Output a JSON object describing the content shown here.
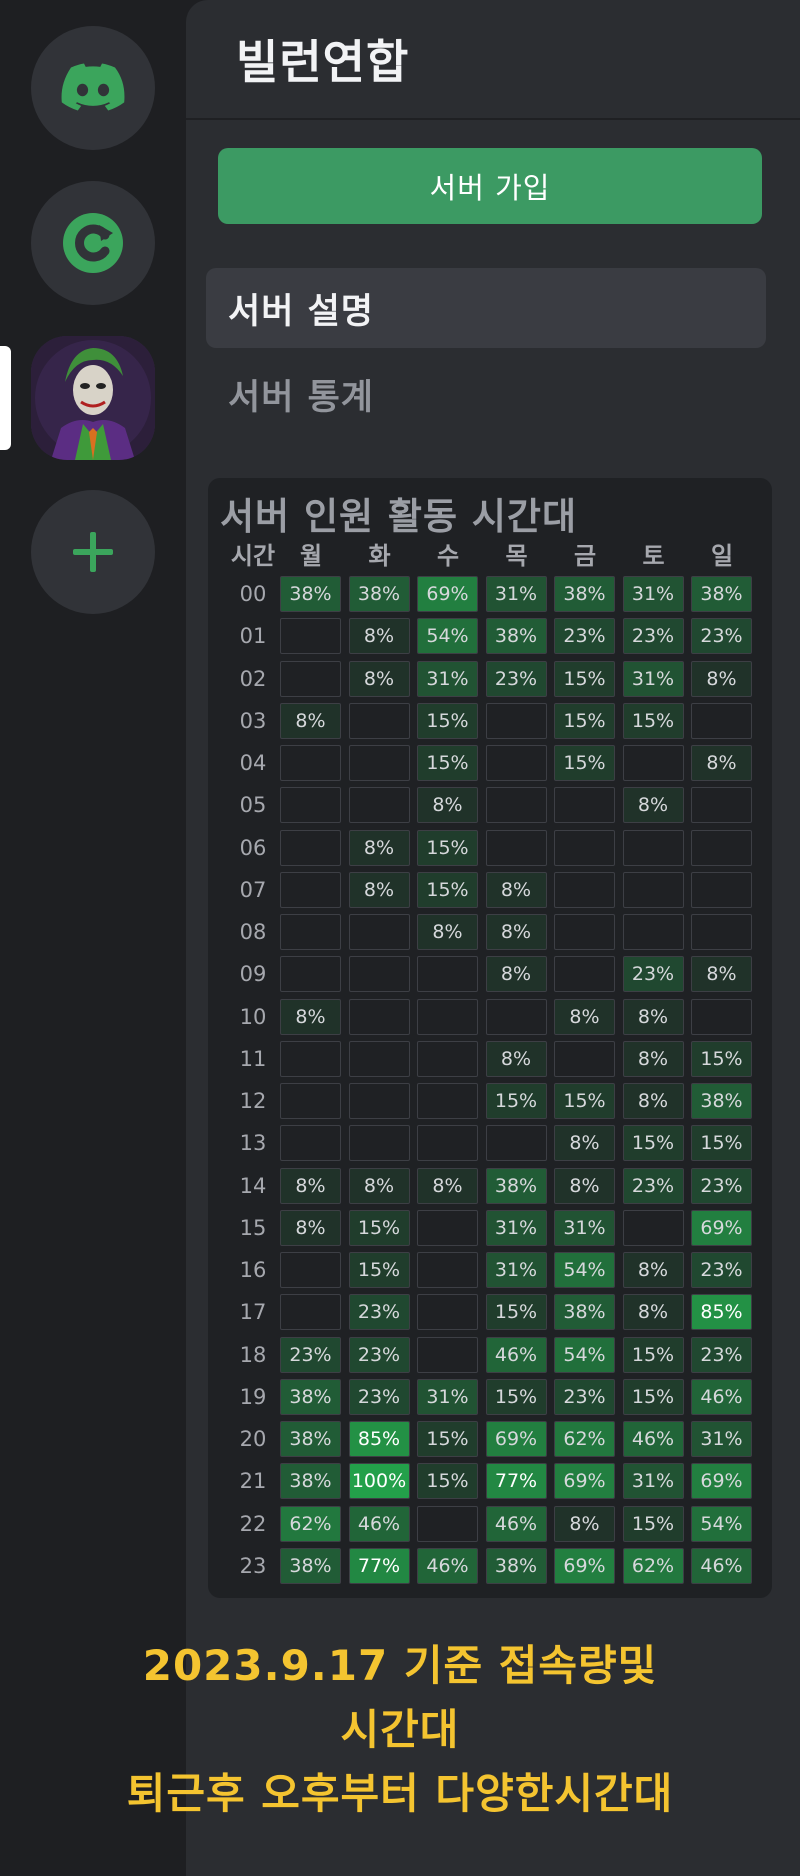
{
  "server": {
    "name": "빌런연합",
    "join_label": "서버 가입"
  },
  "menu": {
    "items": [
      {
        "label": "서버 설명",
        "active": true
      },
      {
        "label": "서버 통계",
        "active": false
      }
    ]
  },
  "stats": {
    "title": "서버 인원 활동 시간대",
    "time_header": "시간",
    "days": [
      "월",
      "화",
      "수",
      "목",
      "금",
      "토",
      "일"
    ],
    "rows": [
      {
        "hour": "00",
        "values": [
          38,
          38,
          69,
          31,
          38,
          31,
          38
        ]
      },
      {
        "hour": "01",
        "values": [
          null,
          8,
          54,
          38,
          23,
          23,
          23
        ]
      },
      {
        "hour": "02",
        "values": [
          null,
          8,
          31,
          23,
          15,
          31,
          8
        ]
      },
      {
        "hour": "03",
        "values": [
          8,
          null,
          15,
          null,
          15,
          15,
          null
        ]
      },
      {
        "hour": "04",
        "values": [
          null,
          null,
          15,
          null,
          15,
          null,
          8
        ]
      },
      {
        "hour": "05",
        "values": [
          null,
          null,
          8,
          null,
          null,
          8,
          null
        ]
      },
      {
        "hour": "06",
        "values": [
          null,
          8,
          15,
          null,
          null,
          null,
          null
        ]
      },
      {
        "hour": "07",
        "values": [
          null,
          8,
          15,
          8,
          null,
          null,
          null
        ]
      },
      {
        "hour": "08",
        "values": [
          null,
          null,
          8,
          8,
          null,
          null,
          null
        ]
      },
      {
        "hour": "09",
        "values": [
          null,
          null,
          null,
          8,
          null,
          23,
          8
        ]
      },
      {
        "hour": "10",
        "values": [
          8,
          null,
          null,
          null,
          8,
          8,
          null
        ]
      },
      {
        "hour": "11",
        "values": [
          null,
          null,
          null,
          8,
          null,
          8,
          15
        ]
      },
      {
        "hour": "12",
        "values": [
          null,
          null,
          null,
          15,
          15,
          8,
          38
        ]
      },
      {
        "hour": "13",
        "values": [
          null,
          null,
          null,
          null,
          8,
          15,
          15
        ]
      },
      {
        "hour": "14",
        "values": [
          8,
          8,
          8,
          38,
          8,
          23,
          23
        ]
      },
      {
        "hour": "15",
        "values": [
          8,
          15,
          null,
          31,
          31,
          null,
          69
        ]
      },
      {
        "hour": "16",
        "values": [
          null,
          15,
          null,
          31,
          54,
          8,
          23
        ]
      },
      {
        "hour": "17",
        "values": [
          null,
          23,
          null,
          15,
          38,
          8,
          85
        ]
      },
      {
        "hour": "18",
        "values": [
          23,
          23,
          null,
          46,
          54,
          15,
          23
        ]
      },
      {
        "hour": "19",
        "values": [
          38,
          23,
          31,
          15,
          23,
          15,
          46
        ]
      },
      {
        "hour": "20",
        "values": [
          38,
          85,
          15,
          69,
          62,
          46,
          31
        ]
      },
      {
        "hour": "21",
        "values": [
          38,
          100,
          15,
          77,
          69,
          31,
          69
        ]
      },
      {
        "hour": "22",
        "values": [
          62,
          46,
          null,
          46,
          8,
          15,
          54
        ]
      },
      {
        "hour": "23",
        "values": [
          38,
          77,
          46,
          38,
          69,
          62,
          46
        ]
      }
    ],
    "colors": {
      "cell_bg": "#1f2124",
      "cell_border": "#3d3f45",
      "heat_max": "#23a04a"
    }
  },
  "caption": {
    "lines": [
      "2023.9.17 기준 접속량및",
      "시간대",
      "퇴근후 오후부터 다양한시간대"
    ]
  },
  "rail": {
    "items": [
      {
        "icon": "discord-logo-icon"
      },
      {
        "icon": "refresh-c-icon"
      },
      {
        "icon": "joker-avatar-icon"
      },
      {
        "icon": "plus-icon"
      }
    ]
  },
  "accent": "#3ba55c"
}
